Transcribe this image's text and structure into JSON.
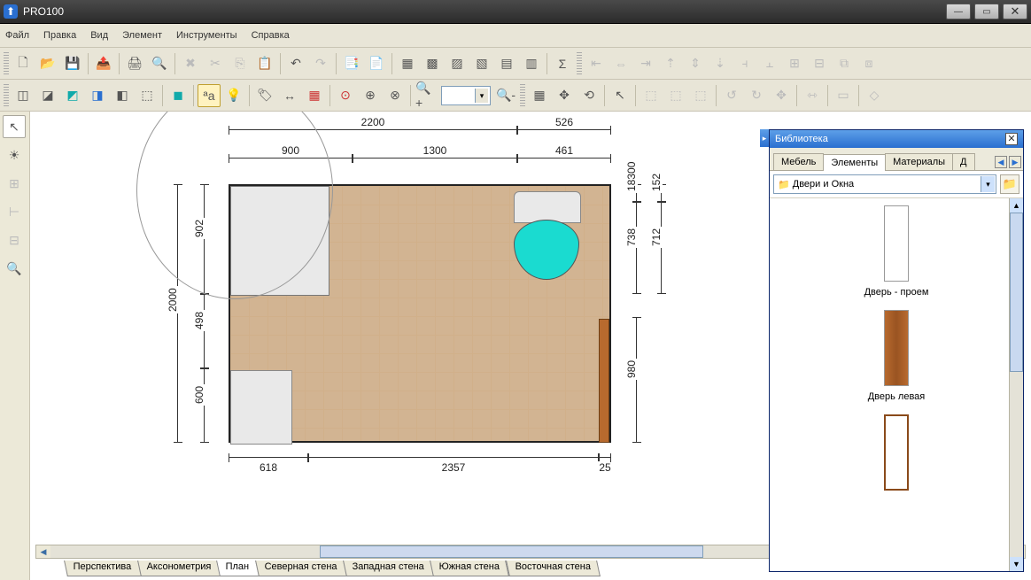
{
  "app": {
    "title": "PRO100"
  },
  "window_controls": {
    "min": "—",
    "max": "▭",
    "close": "✕"
  },
  "menu": {
    "file": "Файл",
    "edit": "Правка",
    "view": "Вид",
    "element": "Элемент",
    "tools": "Инструменты",
    "help": "Справка"
  },
  "toolbar1": {
    "new": "новый",
    "open": "открыть",
    "save": "сохранить",
    "export": "экспорт",
    "print": "печать",
    "preview": "предпросмотр",
    "delete": "удалить",
    "cut": "вырезать",
    "copy": "копировать",
    "paste": "вставить",
    "undo": "отменить",
    "redo": "повторить"
  },
  "toolbar2": {
    "zoom_value": ""
  },
  "left_tools": {
    "pointer": "указатель",
    "light": "освещение",
    "add": "добавить",
    "connect": "связать",
    "dims": "размеры",
    "find": "поиск"
  },
  "tabs": {
    "perspective": "Перспектива",
    "axon": "Аксонометрия",
    "plan": "План",
    "north": "Северная стена",
    "west": "Западная стена",
    "south": "Южная стена",
    "east": "Восточная стена"
  },
  "dimensions": {
    "top1_a": "2200",
    "top1_b": "526",
    "top2_a": "900",
    "top2_b": "1300",
    "top2_c": "461",
    "left_total": "2000",
    "left_a": "902",
    "left_b": "498",
    "left_c": "600",
    "right_a": "152",
    "right_b": "712",
    "right_c": "738",
    "right_d": "980",
    "right_e": "18300",
    "bot_a": "618",
    "bot_b": "2357",
    "bot_c": "25"
  },
  "library": {
    "title": "Библиотека",
    "tabs": {
      "furniture": "Мебель",
      "elements": "Элементы",
      "materials": "Материалы",
      "more": "Д"
    },
    "folder": "Двери и Окна",
    "items": {
      "door_opening": "Дверь - проем",
      "door_left": "Дверь левая"
    }
  }
}
